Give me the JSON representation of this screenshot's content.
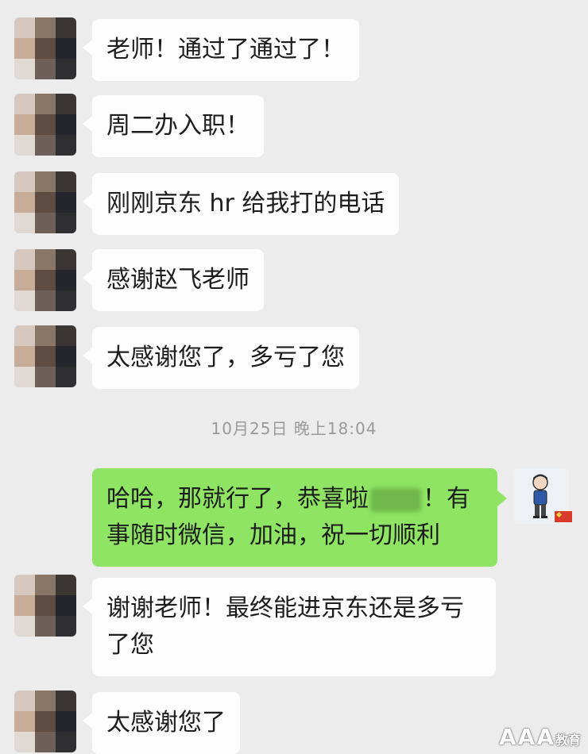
{
  "messages": [
    {
      "side": "left",
      "text": "老师！通过了通过了！"
    },
    {
      "side": "left",
      "text": "周二办入职！"
    },
    {
      "side": "left",
      "text": "刚刚京东 hr 给我打的电话"
    },
    {
      "side": "left",
      "text": "感谢赵飞老师"
    },
    {
      "side": "left",
      "text": "太感谢您了，多亏了您"
    },
    {
      "side": "right",
      "text_before": "哈哈，那就行了，恭喜啦",
      "text_after": "！有事随时微信，加油，祝一切顺利"
    },
    {
      "side": "left",
      "text": "谢谢老师！最终能进京东还是多亏了您"
    },
    {
      "side": "left",
      "text": "太感谢您了"
    }
  ],
  "timestamp": "10月25日 晚上18:04",
  "watermark": {
    "main": "AAA",
    "small": "教育"
  },
  "colors": {
    "background": "#ececec",
    "incoming_bubble": "#fdfdfd",
    "outgoing_bubble": "#8fe563"
  }
}
